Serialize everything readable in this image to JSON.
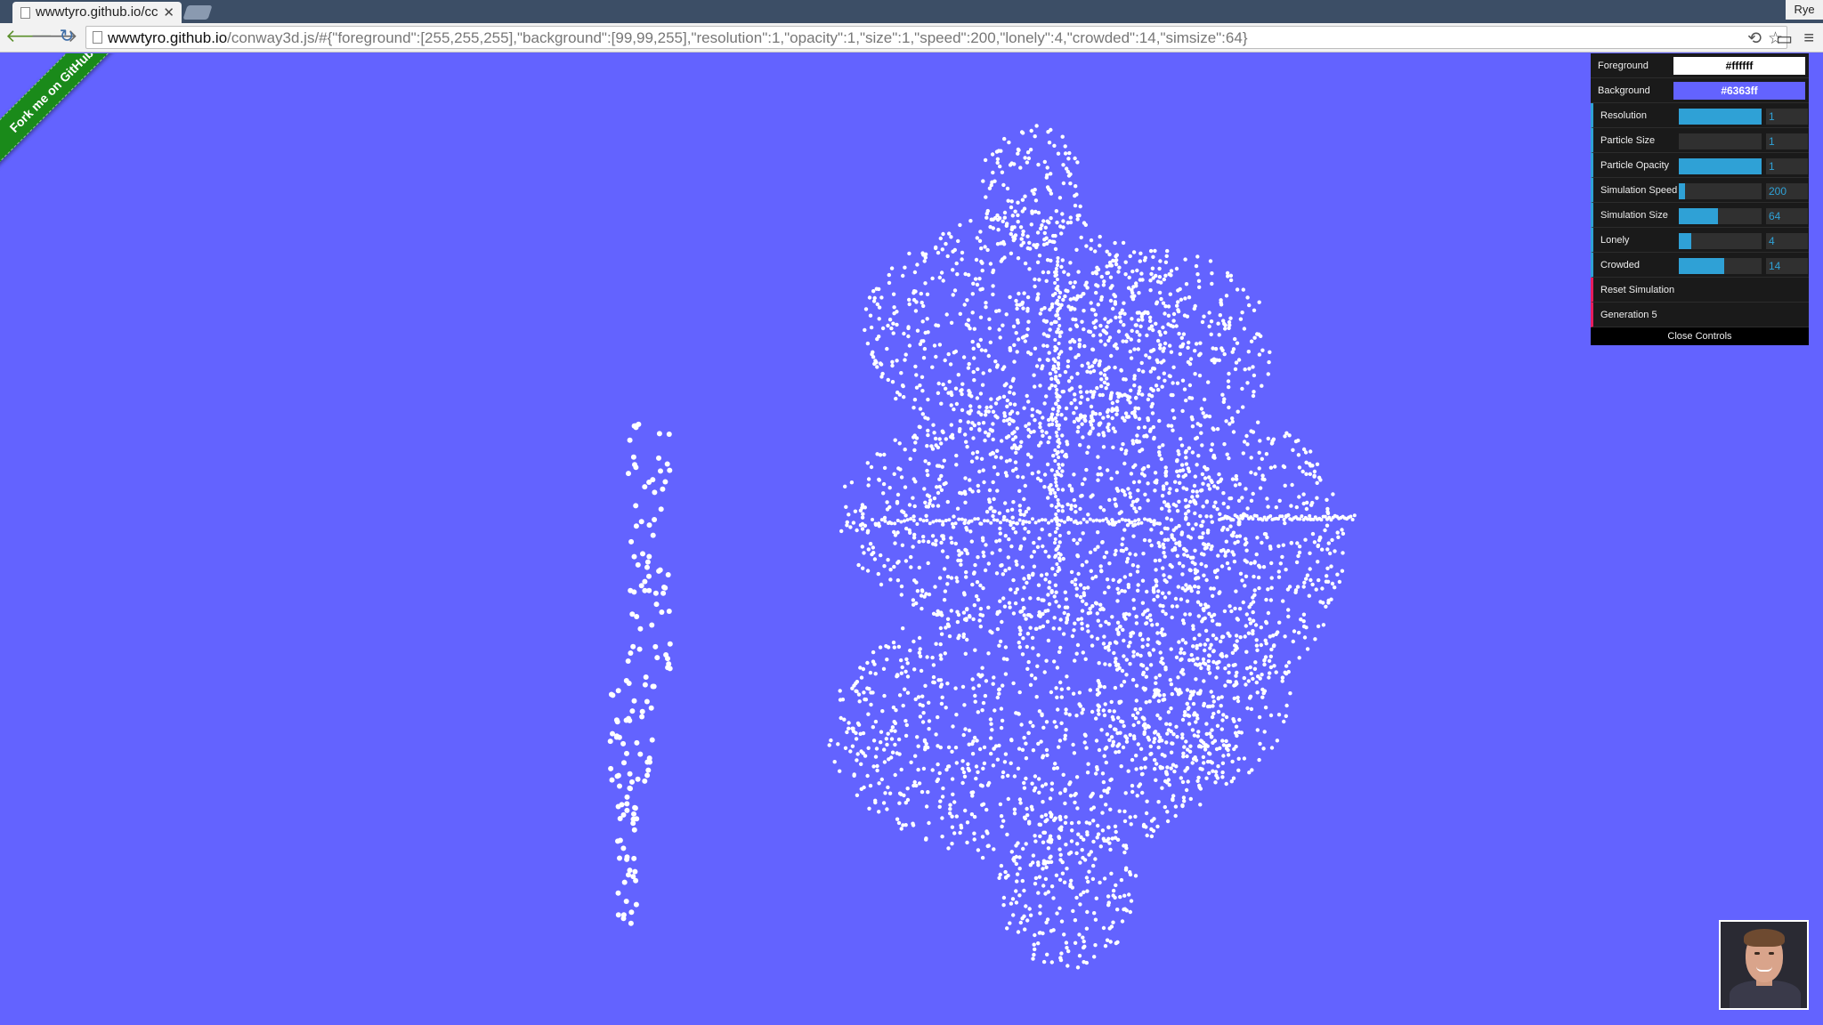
{
  "browser": {
    "tab_title": "wwwtyro.github.io/cc",
    "user_name": "Rye",
    "url_domain": "wwwtyro.github.io",
    "url_path": "/conway3d.js/#{\"foreground\":[255,255,255],\"background\":[99,99,255],\"resolution\":1,\"opacity\":1,\"size\":1,\"speed\":200,\"lonely\":4,\"crowded\":14,\"simsize\":64}"
  },
  "page": {
    "ribbon_text": "Fork me on GitHub",
    "background_color": "#6363ff",
    "particle_color": "#ffffff"
  },
  "controls": {
    "foreground": {
      "label": "Foreground",
      "value": "#ffffff"
    },
    "background": {
      "label": "Background",
      "value": "#6363ff"
    },
    "resolution": {
      "label": "Resolution",
      "value": "1",
      "fraction": 1.0
    },
    "particle_size": {
      "label": "Particle Size",
      "value": "1",
      "fraction": 0.0
    },
    "particle_opacity": {
      "label": "Particle Opacity",
      "value": "1",
      "fraction": 1.0
    },
    "simulation_speed": {
      "label": "Simulation Speed",
      "value": "200",
      "fraction": 0.08
    },
    "simulation_size": {
      "label": "Simulation Size",
      "value": "64",
      "fraction": 0.47
    },
    "lonely": {
      "label": "Lonely",
      "value": "4",
      "fraction": 0.15
    },
    "crowded": {
      "label": "Crowded",
      "value": "14",
      "fraction": 0.55
    },
    "reset_label": "Reset Simulation",
    "generation_label": "Generation 5",
    "close_label": "Close Controls"
  },
  "icons": {
    "back": "back-arrow-icon",
    "forward": "forward-arrow-icon",
    "reload": "reload-icon",
    "page": "page-icon",
    "history": "history-icon",
    "bookmark": "star-icon",
    "cast": "cast-icon",
    "menu": "hamburger-menu-icon"
  }
}
